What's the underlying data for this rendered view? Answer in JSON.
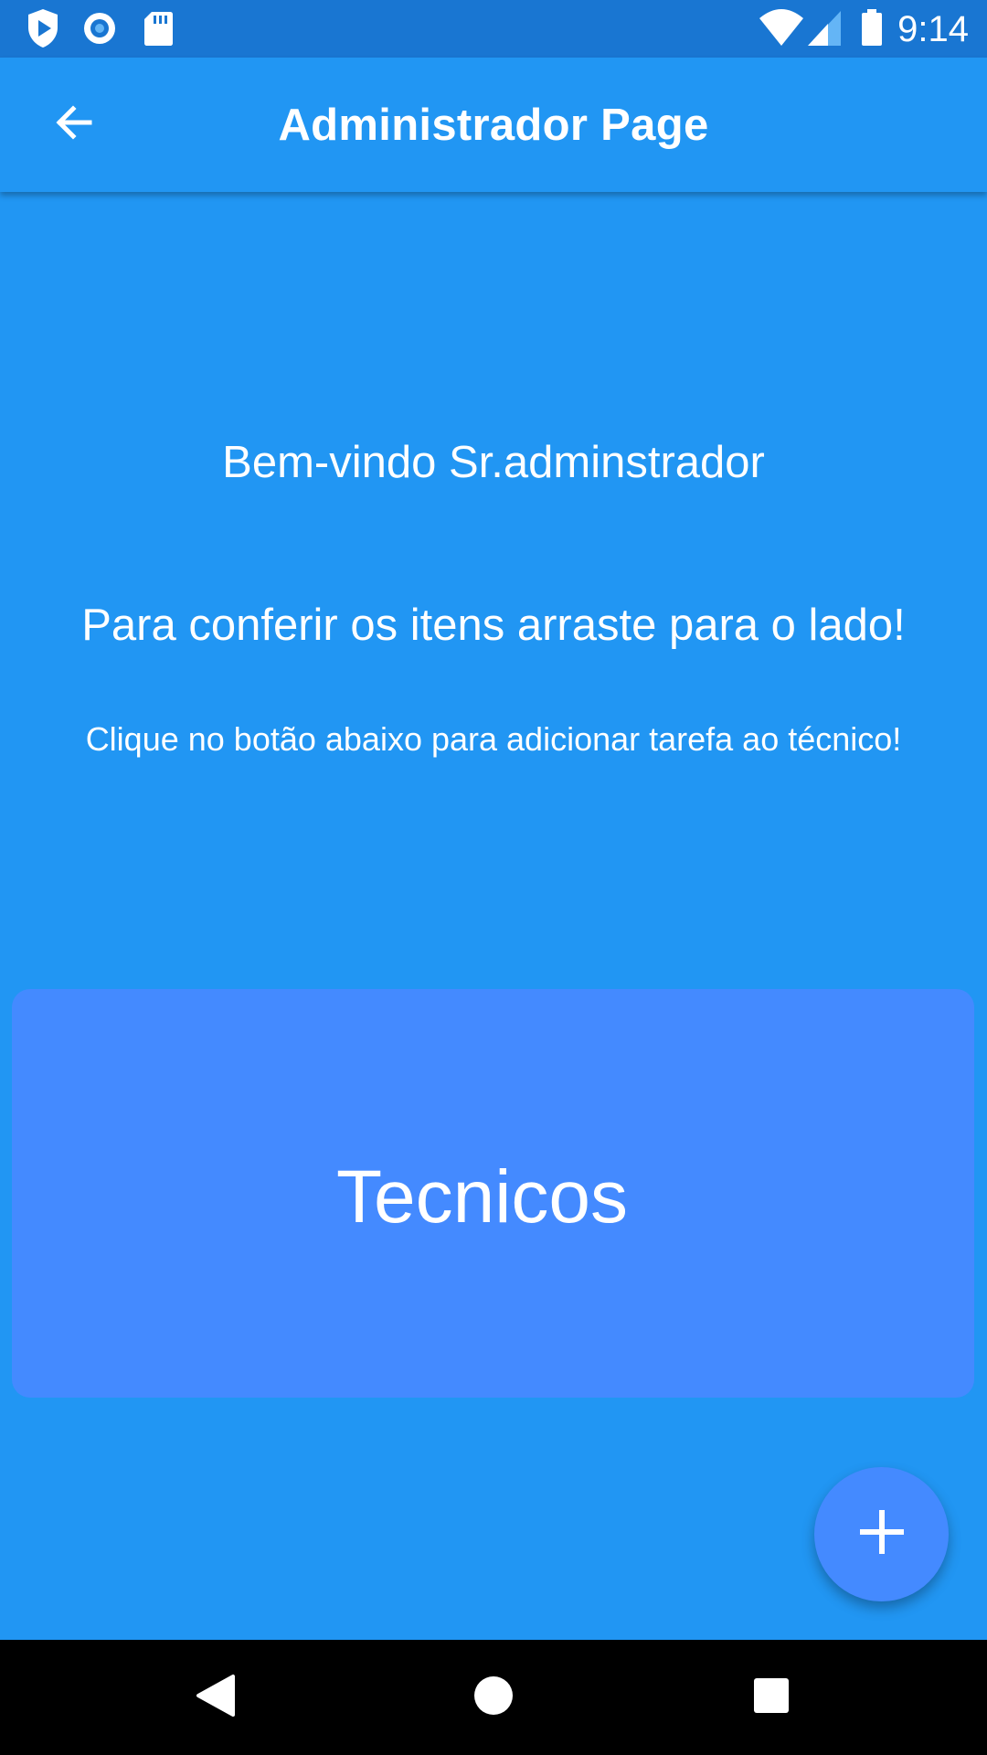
{
  "status_bar": {
    "time": "9:14",
    "icons": [
      "play-shield-icon",
      "record-icon",
      "sd-card-icon",
      "wifi-icon",
      "cell-signal-icon",
      "battery-icon"
    ]
  },
  "app_bar": {
    "title": "Administrador Page",
    "back_icon": "arrow-back-icon"
  },
  "body": {
    "welcome": "Bem-vindo Sr.adminstrador",
    "drag_hint": "Para conferir os itens arraste para o lado!",
    "click_hint": "Clique no botão abaixo para adicionar tarefa ao técnico!"
  },
  "card": {
    "label": "Tecnicos"
  },
  "fab": {
    "icon": "plus-icon"
  },
  "nav_bar": {
    "icons": [
      "back-triangle-icon",
      "home-circle-icon",
      "recents-square-icon"
    ]
  },
  "colors": {
    "background": "#2196F3",
    "status_bar": "#1976D2",
    "card": "#448AFF",
    "fab": "#448AFF",
    "nav_bar": "#000000",
    "text": "#FFFFFF"
  }
}
